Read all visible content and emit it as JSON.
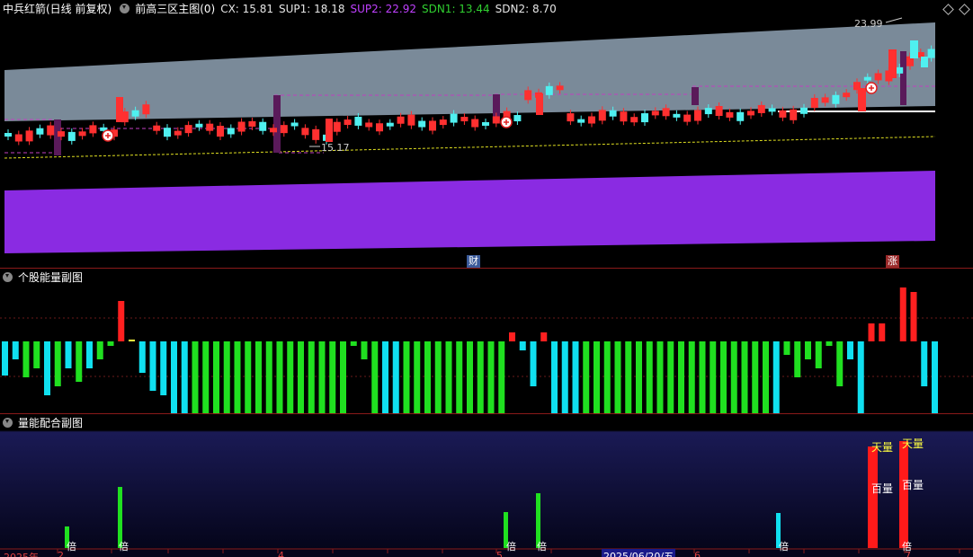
{
  "main": {
    "title": "中兵红箭(日线 前复权)",
    "indicator": "前高三区主图(0)",
    "cx": "CX: 15.81",
    "sup1": "SUP1: 18.18",
    "sup2": "SUP2: 22.92",
    "sdn1": "SDN1: 13.44",
    "sdn2": "SDN2: 8.70",
    "high_label": "23.99",
    "low_label": "15.17",
    "marker_cai": "财",
    "marker_zhang": "涨",
    "colors": {
      "up": "#ff3030",
      "down": "#4ff0f0",
      "band": "#7a8a99",
      "purple": "#8a2be2",
      "dash": "#c040c0",
      "yellow": "#e0e020",
      "cx": "#e6e6e6",
      "sup1": "#e6e6e6",
      "sup2": "#c040ff",
      "sdn1": "#30d030",
      "sdn2": "#e6e6e6"
    }
  },
  "sub1": {
    "title": "个股能量副图",
    "colors": {
      "cyan": "#10e0f0",
      "green": "#20e020",
      "red": "#ff2020",
      "yellow": "#ffff40"
    }
  },
  "sub2": {
    "title": "量能配合副图",
    "tag_bei": "倍",
    "tag_tianliang": "天量",
    "tag_bailiang": "百量"
  },
  "xaxis": {
    "year": "2025年",
    "m2": "2",
    "m4": "4",
    "m5": "5",
    "m6": "6",
    "m7": "7",
    "cursor_date": "2025/06/20/五"
  }
}
